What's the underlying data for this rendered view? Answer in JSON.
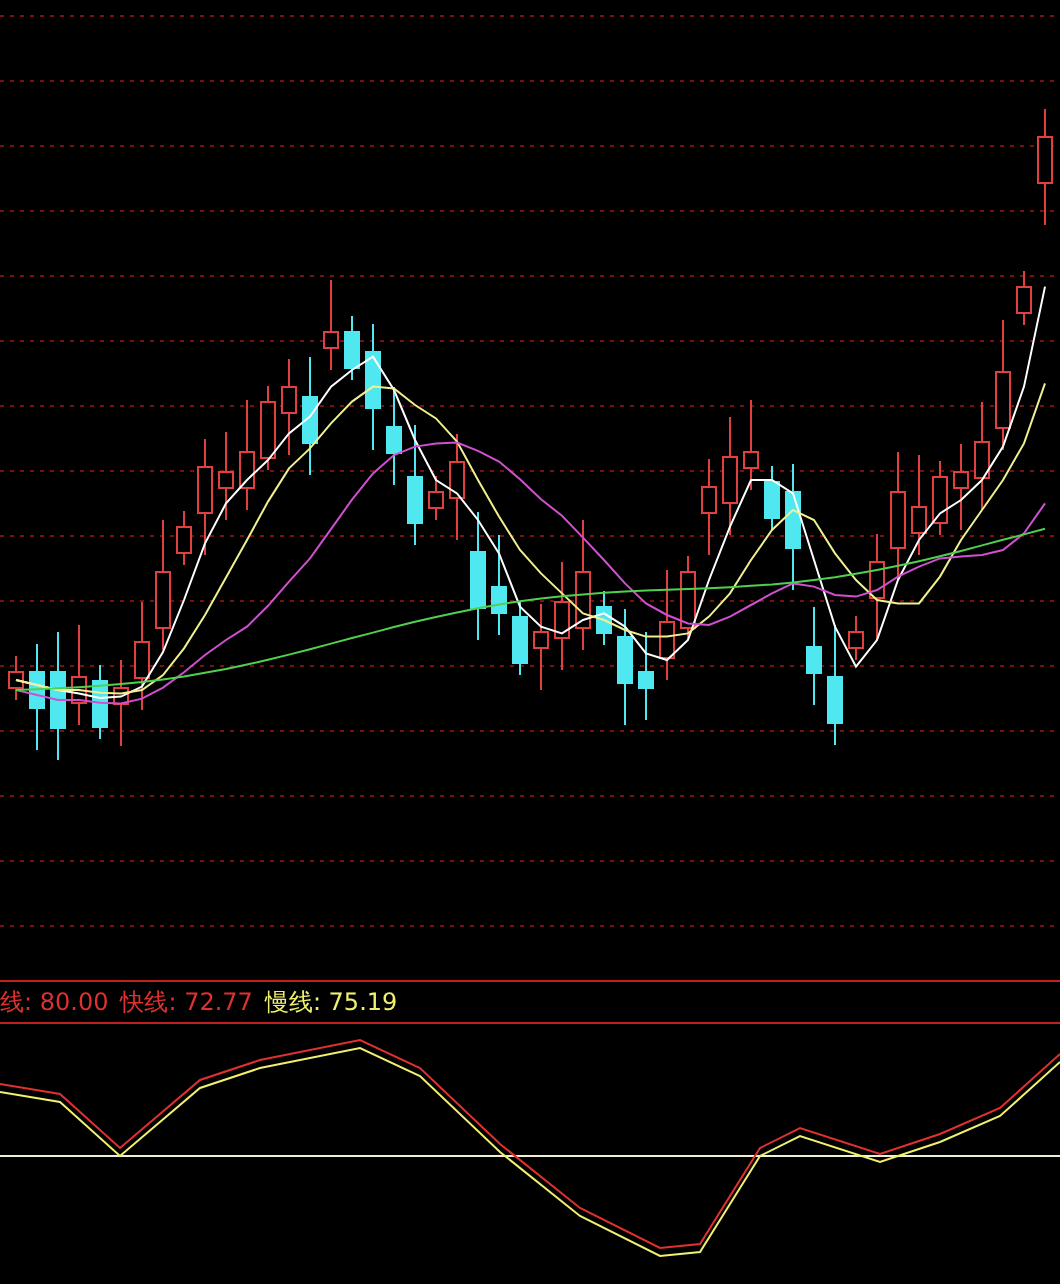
{
  "indicator_legend": [
    {
      "label": "线:",
      "value": "80.00",
      "color": "#e03030"
    },
    {
      "label": "快线:",
      "value": "72.77",
      "color": "#e03030"
    },
    {
      "label": "慢线:",
      "value": "75.19",
      "color": "#f0f070"
    }
  ]
}
